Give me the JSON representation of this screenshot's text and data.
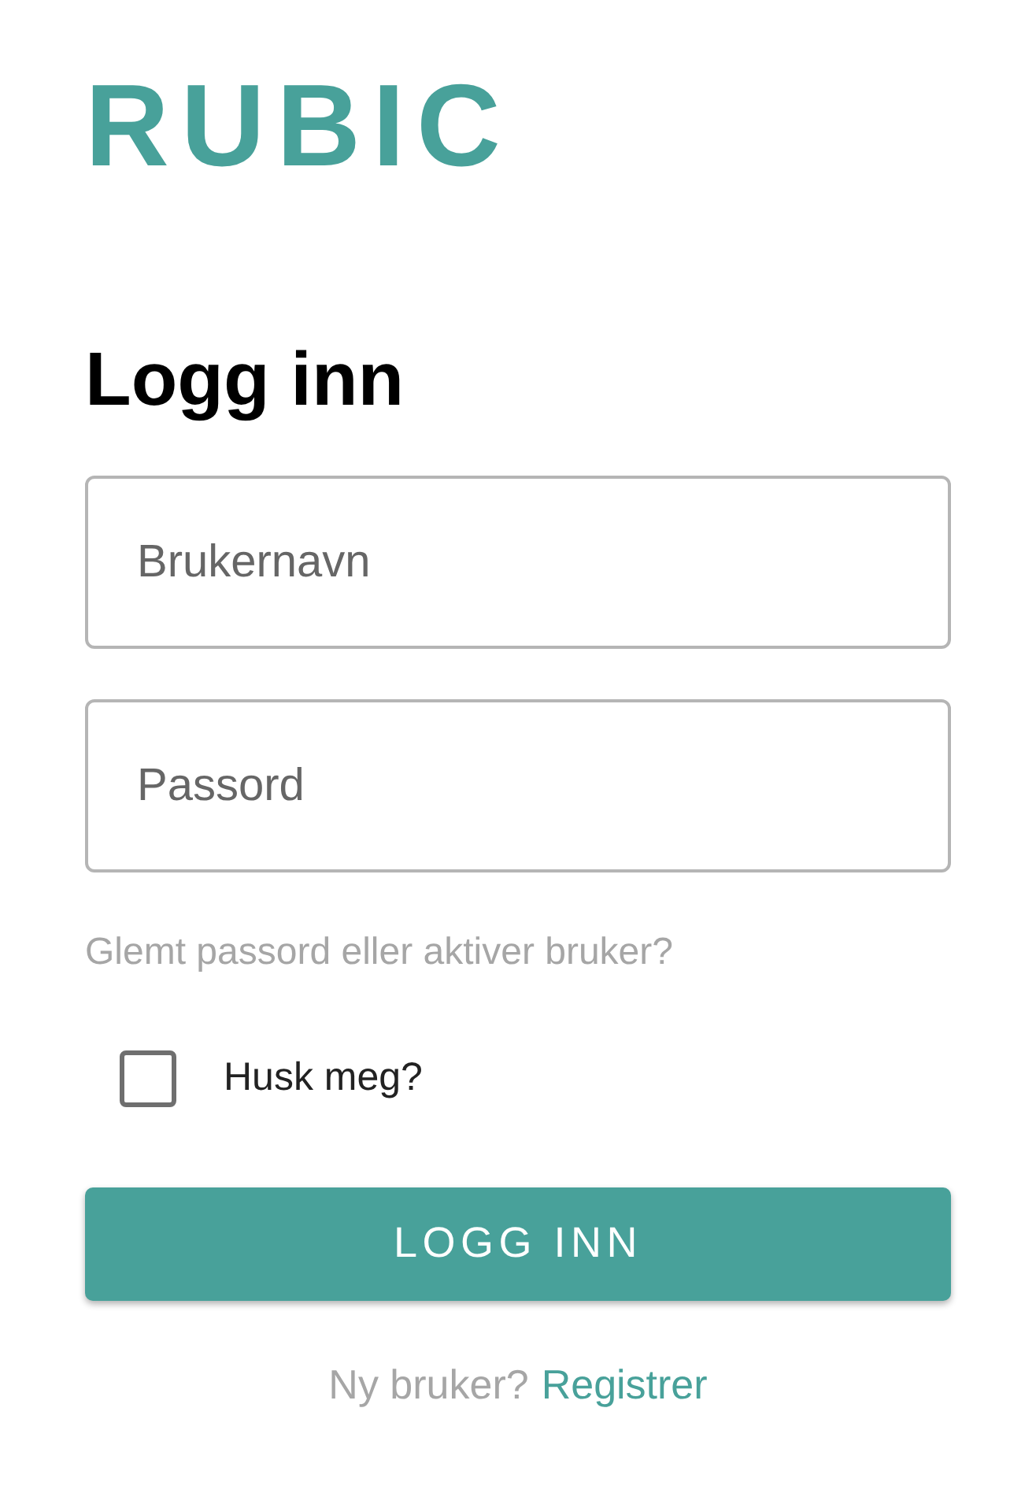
{
  "logo": "RUBIC",
  "title": "Logg inn",
  "fields": [
    {
      "placeholder": "Brukernavn"
    },
    {
      "placeholder": "Passord"
    }
  ],
  "forgot_link": "Glemt passord eller aktiver bruker?",
  "remember": {
    "label": "Husk meg?",
    "checked": false
  },
  "submit_button": "LOGG INN",
  "footer": {
    "text": "Ny bruker?",
    "link": "Registrer"
  }
}
